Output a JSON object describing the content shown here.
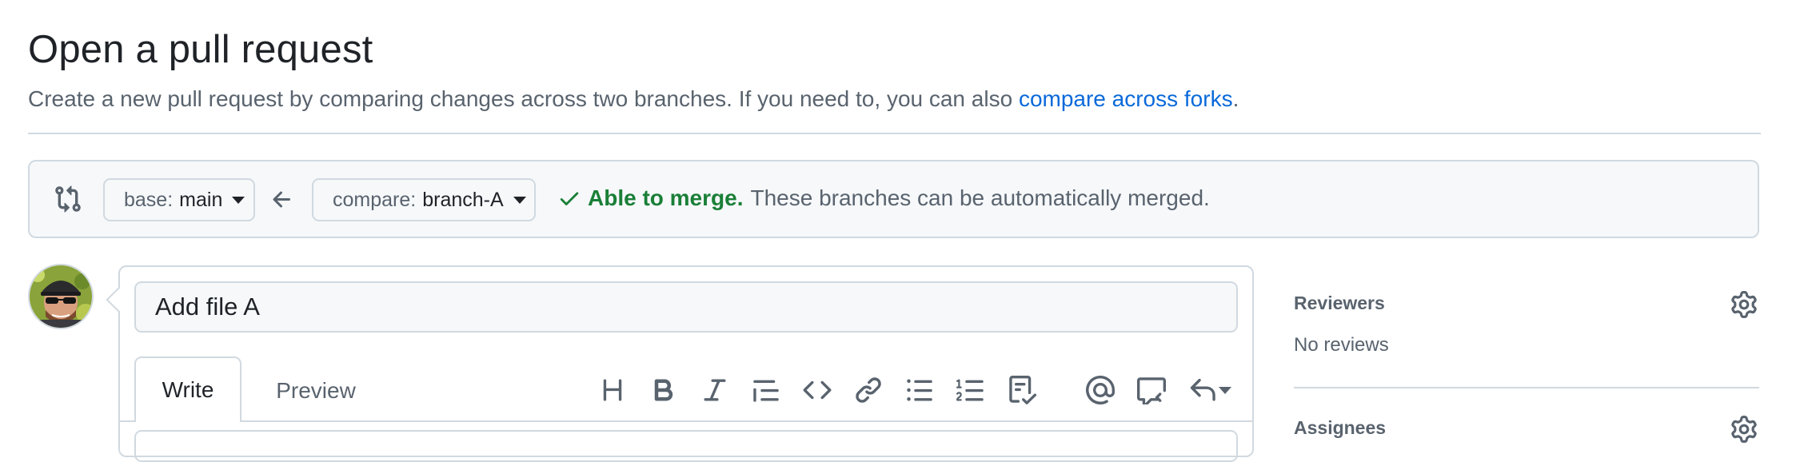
{
  "page": {
    "title": "Open a pull request",
    "subtitle_text": "Create a new pull request by comparing changes across two branches. If you need to, you can also ",
    "subtitle_link": "compare across forks",
    "subtitle_end": "."
  },
  "compare": {
    "base_label": "base:",
    "base_value": "main",
    "compare_label": "compare:",
    "compare_value": "branch-A",
    "merge_ok": "Able to merge.",
    "merge_detail": "These branches can be automatically merged."
  },
  "editor": {
    "title_value": "Add file A",
    "tabs": [
      {
        "label": "Write"
      },
      {
        "label": "Preview"
      }
    ],
    "toolbar_icons": [
      "heading-icon",
      "bold-icon",
      "italic-icon",
      "quote-icon",
      "code-icon",
      "link-icon",
      "bulleted-list-icon",
      "numbered-list-icon",
      "task-list-icon",
      "mention-icon",
      "reference-icon",
      "reply-icon"
    ]
  },
  "sidebar": {
    "reviewers": {
      "heading": "Reviewers",
      "value": "No reviews"
    },
    "assignees": {
      "heading": "Assignees"
    }
  },
  "colors": {
    "link": "#0969da",
    "success": "#1a7f37",
    "border": "#d1d9e0",
    "muted_text": "#59636e"
  }
}
